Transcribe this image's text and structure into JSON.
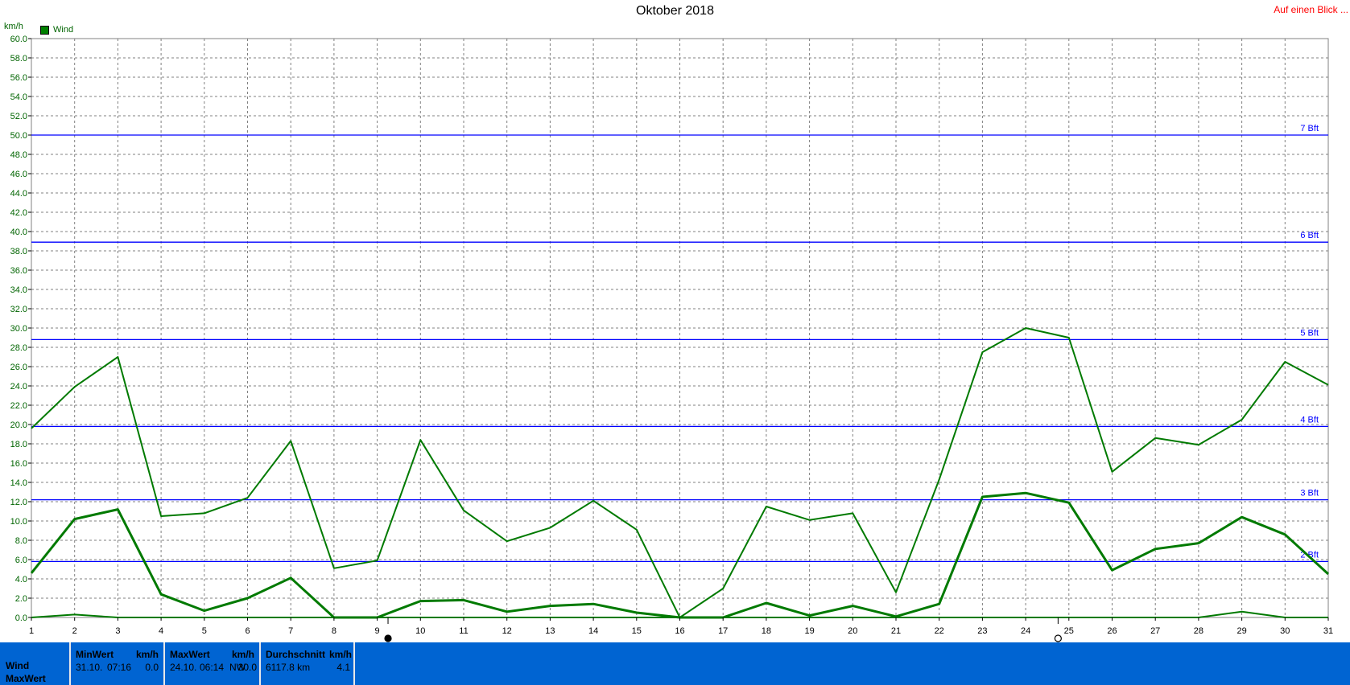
{
  "header": {
    "title": "Oktober 2018",
    "quick_link": "Auf einen Blick ...",
    "unit": "km/h",
    "legend_label": "Wind"
  },
  "colors": {
    "series": "#007a00",
    "grid": "#808080",
    "beaufort": "#0000ff",
    "footer": "#0064d2",
    "link": "#ff0000",
    "axis_text": "#006400"
  },
  "chart_data": {
    "type": "line",
    "title": "Oktober 2018",
    "ylabel": "km/h",
    "xlabel": "",
    "ylim": [
      0,
      60
    ],
    "yticks": [
      "0.0",
      "2.0",
      "4.0",
      "6.0",
      "8.0",
      "10.0",
      "12.0",
      "14.0",
      "16.0",
      "18.0",
      "20.0",
      "22.0",
      "24.0",
      "26.0",
      "28.0",
      "30.0",
      "32.0",
      "34.0",
      "36.0",
      "38.0",
      "40.0",
      "42.0",
      "44.0",
      "46.0",
      "48.0",
      "50.0",
      "52.0",
      "54.0",
      "56.0",
      "58.0",
      "60.0"
    ],
    "x": [
      1,
      2,
      3,
      4,
      5,
      6,
      7,
      8,
      9,
      10,
      11,
      12,
      13,
      14,
      15,
      16,
      17,
      18,
      19,
      20,
      21,
      22,
      23,
      24,
      25,
      26,
      27,
      28,
      29,
      30,
      31
    ],
    "grid": true,
    "legend": "top-left",
    "series": [
      {
        "name": "Wind",
        "line": "max",
        "values": [
          19.6,
          23.9,
          27.0,
          10.5,
          10.8,
          12.4,
          18.3,
          5.1,
          5.9,
          18.4,
          11.1,
          7.9,
          9.3,
          12.1,
          9.1,
          0.0,
          3.0,
          11.5,
          10.1,
          10.8,
          2.6,
          14.3,
          27.5,
          30.0,
          29.0,
          15.1,
          18.6,
          17.9,
          20.5,
          26.5,
          24.1
        ]
      },
      {
        "name": "Wind",
        "line": "avg",
        "values": [
          4.6,
          10.2,
          11.2,
          2.4,
          0.7,
          2.0,
          4.1,
          0.0,
          0.0,
          1.7,
          1.8,
          0.6,
          1.2,
          1.4,
          0.5,
          0.0,
          0.0,
          1.5,
          0.2,
          1.2,
          0.1,
          1.4,
          12.5,
          12.9,
          11.9,
          4.9,
          7.1,
          7.7,
          10.4,
          8.6,
          4.5
        ]
      },
      {
        "name": "Wind",
        "line": "min",
        "values": [
          0.0,
          0.3,
          0.0,
          0.0,
          0.0,
          0.0,
          0.0,
          0.0,
          0.0,
          0.0,
          0.0,
          0.0,
          0.0,
          0.0,
          0.0,
          0.0,
          0.0,
          0.0,
          0.0,
          0.0,
          0.0,
          0.0,
          0.0,
          0.0,
          0.0,
          0.0,
          0.0,
          0.0,
          0.6,
          0.0,
          0.0
        ]
      }
    ],
    "reference_lines": [
      {
        "label": "2 Bft",
        "value": 5.8
      },
      {
        "label": "3 Bft",
        "value": 12.2
      },
      {
        "label": "4 Bft",
        "value": 19.8
      },
      {
        "label": "5 Bft",
        "value": 28.8
      },
      {
        "label": "6 Bft",
        "value": 38.9
      },
      {
        "label": "7 Bft",
        "value": 50.0
      }
    ],
    "markers": [
      {
        "x": 9.25,
        "type": "new-moon"
      },
      {
        "x": 24.75,
        "type": "full-moon"
      }
    ]
  },
  "footer": {
    "row_labels": [
      "Wind",
      "MaxWert"
    ],
    "min": {
      "header": "MinWert",
      "unit": "km/h",
      "date": "31.10.",
      "time": "07:16",
      "value": "0.0"
    },
    "max": {
      "header": "MaxWert",
      "unit": "km/h",
      "date": "24.10.",
      "time": "06:14",
      "dir": "NW",
      "value": "30.0"
    },
    "avg": {
      "header": "Durchschnitt",
      "unit": "km/h",
      "distance": "6117.8 km",
      "value": "4.1"
    }
  }
}
